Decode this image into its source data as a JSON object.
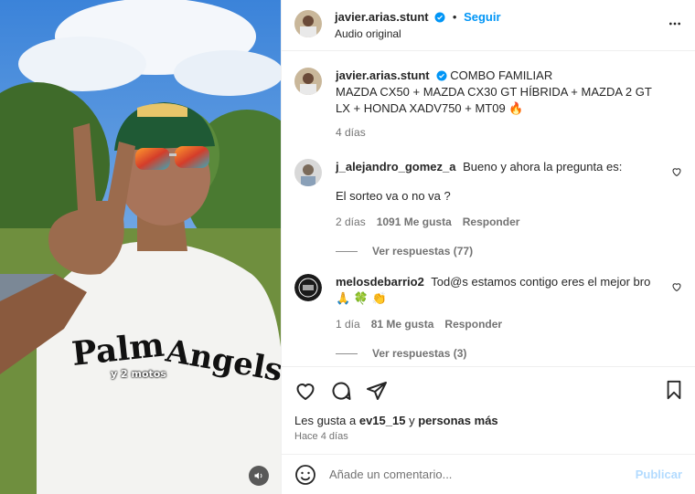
{
  "post": {
    "username": "javier.arias.stunt",
    "follow_label": "Seguir",
    "dot": "•",
    "audio": "Audio original",
    "caption_lead": "COMBO FAMILIAR",
    "caption_body": "MAZDA CX50 + MAZDA CX30 GT HÍBRIDA + MAZDA 2 GT LX + HONDA XADV750 + MT09 🔥",
    "caption_time": "4 días",
    "video_sticker_text": "y 2 motos"
  },
  "comments": [
    {
      "username": "j_alejandro_gomez_a",
      "text_line1": "Bueno y ahora la pregunta es:",
      "text_line2": "El sorteo va o no va ?",
      "time": "2 días",
      "likes": "1091 Me gusta",
      "reply_label": "Responder",
      "view_replies": "Ver respuestas (77)"
    },
    {
      "username": "melosdebarrio2",
      "text": "Tod@s estamos contigo eres el mejor bro 🙏 🍀 👏",
      "time": "1 día",
      "likes": "81 Me gusta",
      "reply_label": "Responder",
      "view_replies": "Ver respuestas (3)"
    }
  ],
  "likes_line": {
    "prefix": "Les gusta a",
    "user": "ev15_15",
    "middle": "y",
    "others": "personas más"
  },
  "posted_ago": "Hace 4 días",
  "add_comment": {
    "placeholder": "Añade un comentario...",
    "publish_label": "Publicar"
  },
  "colors": {
    "accent": "#0095f6",
    "publish_disabled": "#b3dbff",
    "secondary_text": "#737373"
  },
  "icons": [
    "heart-icon",
    "comment-icon",
    "share-icon",
    "bookmark-icon",
    "emoji-icon",
    "more-icon",
    "verified-icon",
    "sound-icon"
  ]
}
